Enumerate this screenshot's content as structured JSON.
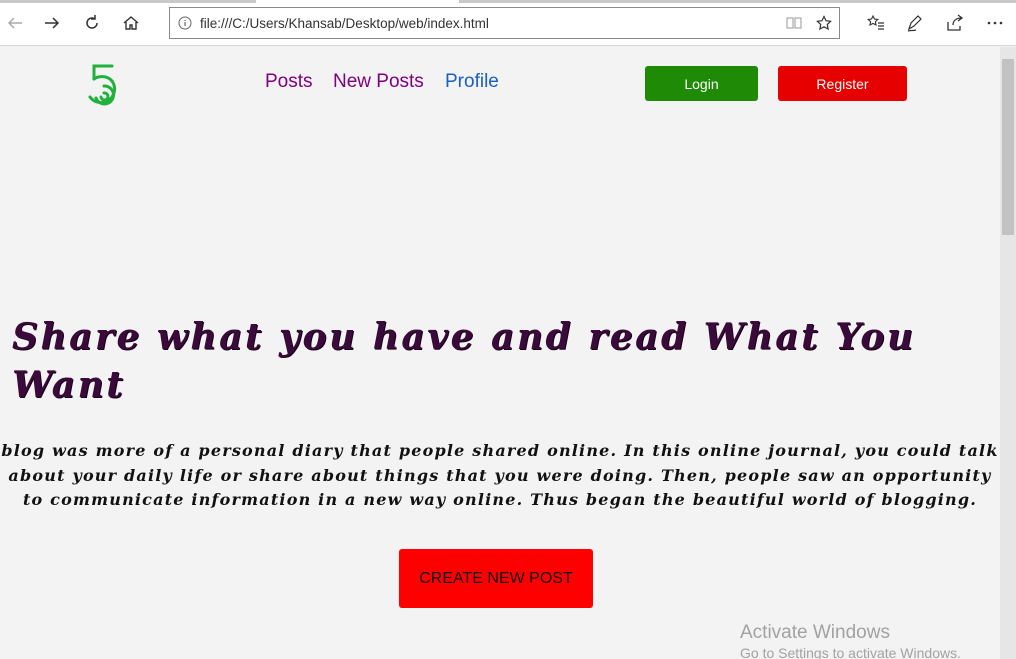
{
  "browser": {
    "url": "file:///C:/Users/Khansab/Desktop/web/index.html",
    "icons": {
      "back": "back-arrow-icon",
      "forward": "forward-arrow-icon",
      "refresh": "refresh-icon",
      "home": "home-icon",
      "info": "info-icon",
      "reading_view": "reading-view-icon",
      "favorite": "star-icon",
      "favorites_hub": "favorites-list-icon",
      "notes": "pen-icon",
      "share": "share-icon",
      "more": "more-icon"
    }
  },
  "header": {
    "logo_icon": "five-logo-icon",
    "logo_color": "#1fb23a",
    "nav": [
      {
        "label": "Posts"
      },
      {
        "label": "New Posts"
      },
      {
        "label": "Profile"
      }
    ],
    "login_label": "Login",
    "register_label": "Register"
  },
  "hero": {
    "title": "Share what you have and read What You Want",
    "text": "blog was more of a personal diary that people shared online. In this online journal, you could talk about your daily life or share about things that you were doing. Then, people saw an opportunity to communicate information in a new way online. Thus began the beautiful world of blogging.",
    "cta_label": "CREATE NEW POST"
  },
  "watermark": {
    "title": "Activate Windows",
    "subtitle": "Go to Settings to activate Windows."
  },
  "colors": {
    "login": "#1e8a05",
    "register": "#e60000",
    "cta": "#ff0000",
    "nav_visited": "#800080",
    "nav_link": "#1a5fc4",
    "title": "#3a0a3a"
  }
}
